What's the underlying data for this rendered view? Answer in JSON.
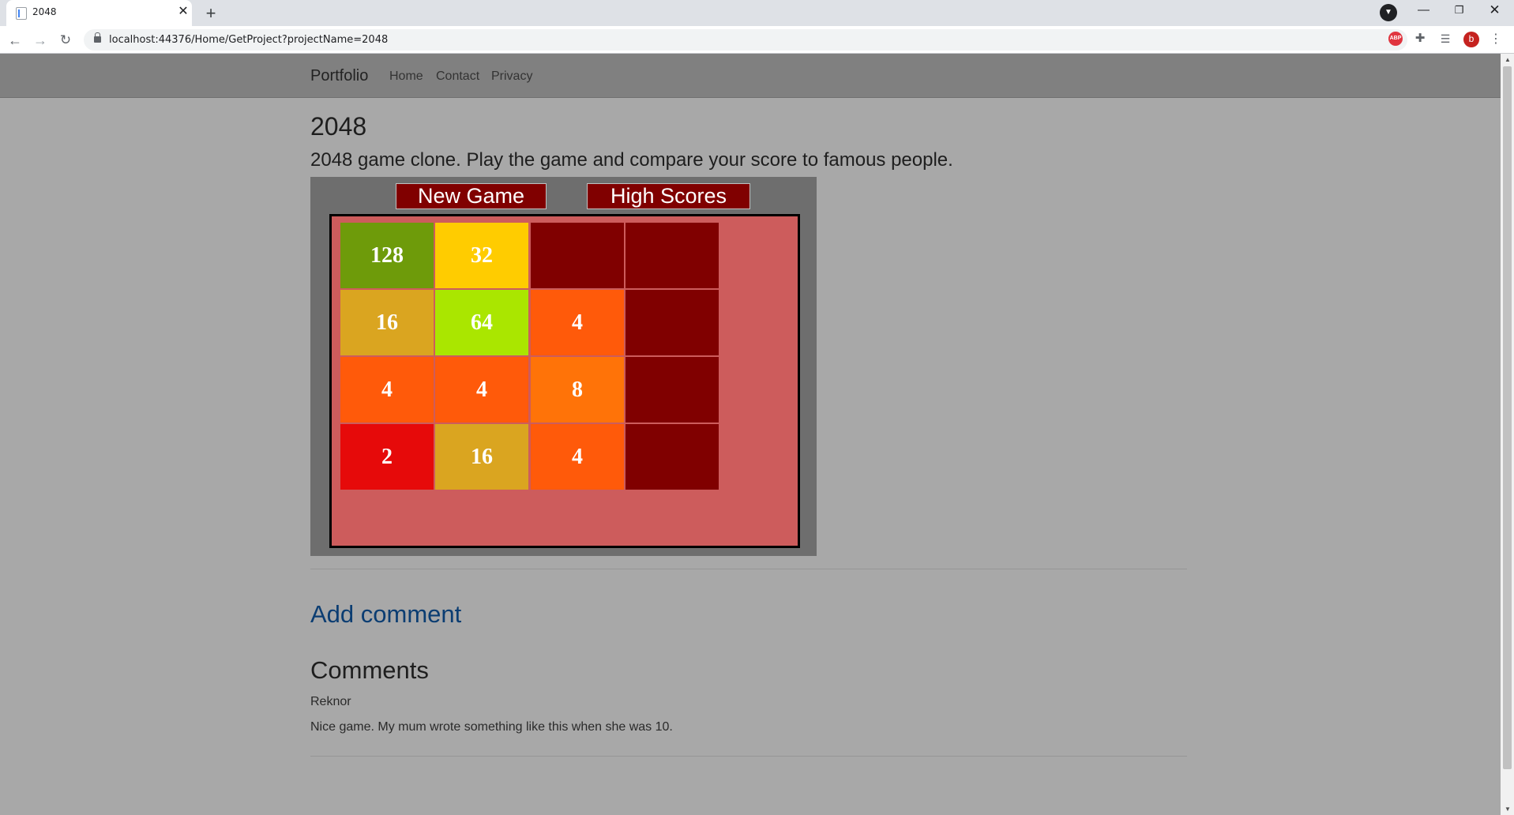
{
  "browser": {
    "tab_title": "2048",
    "tab_close": "✕",
    "new_tab": "+",
    "url": "localhost:44376/Home/GetProject?projectName=2048",
    "icons": {
      "back": "arrow-left-icon",
      "forward": "arrow-right-icon",
      "reload": "reload-icon",
      "lock": "lock-icon",
      "bookmark": "star-icon",
      "adblock": "abp-icon",
      "extensions": "puzzle-icon",
      "media": "media-queue-icon",
      "menu": "more-vert-icon"
    },
    "profile_initial": "b",
    "window_controls": {
      "minimize": "—",
      "maximize": "❐",
      "close": "✕"
    }
  },
  "navbar": {
    "brand": "Portfolio",
    "links": [
      "Home",
      "Contact",
      "Privacy"
    ]
  },
  "project": {
    "title": "2048",
    "description": "2048 game clone. Play the game and compare your score to famous people."
  },
  "game": {
    "new_game_label": "New Game",
    "high_scores_label": "High Scores",
    "colors": {
      "frame": "#6e6e6e",
      "board": "#cd5c5c",
      "empty": "#800000",
      "2": "#e60a0a",
      "4": "#ff5a0a",
      "8": "#ff7308",
      "16": "#daa520",
      "32": "#ffcc00",
      "64": "#aae600",
      "128": "#6e9b0a"
    },
    "grid": [
      [
        "128",
        "32",
        "",
        ""
      ],
      [
        "16",
        "64",
        "4",
        ""
      ],
      [
        "4",
        "4",
        "8",
        ""
      ],
      [
        "2",
        "16",
        "4",
        ""
      ]
    ]
  },
  "comments_section": {
    "add_comment": "Add comment",
    "title": "Comments",
    "items": [
      {
        "author": "Reknor",
        "text": "Nice game. My mum wrote something like this when she was 10."
      }
    ]
  }
}
